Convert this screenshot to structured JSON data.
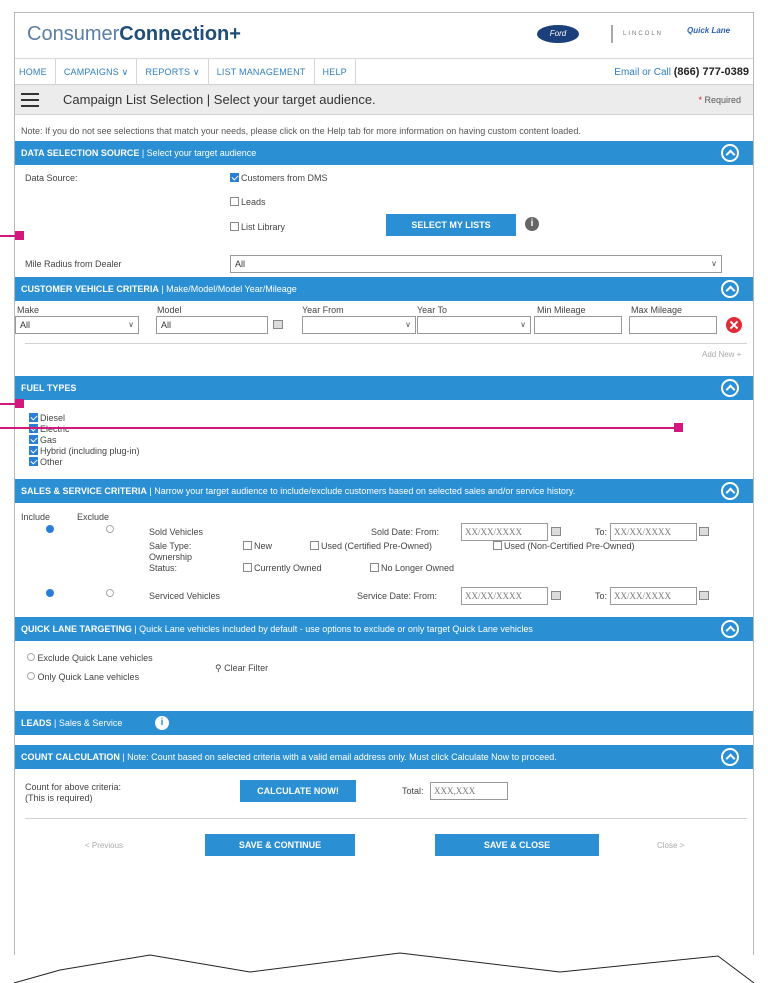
{
  "header": {
    "brand_light": "Consumer",
    "brand_bold": "Connection+",
    "ford_logo": "Ford",
    "lincoln_logo": "LINCOLN",
    "quicklane_logo": "Quick Lane"
  },
  "nav": {
    "items": [
      "HOME",
      "CAMPAIGNS ∨",
      "REPORTS ∨",
      "LIST MANAGEMENT",
      "HELP"
    ],
    "contact_prefix": "Email or Call",
    "contact_phone": "(866) 777-0389"
  },
  "titlebar": {
    "title": "Campaign List Selection | Select your target audience.",
    "required_star": "*",
    "required_label": "Required"
  },
  "note": "Note: If you do not see selections that match your needs, please click on the Help tab for more information on having custom content loaded.",
  "data_source": {
    "bar_title": "DATA SELECTION SOURCE",
    "bar_sub": " | Select your target audience",
    "label": "Data Source:",
    "options": [
      "Customers from DMS",
      "Leads",
      "List Library"
    ],
    "checked": [
      true,
      false,
      false
    ],
    "select_lists_button": "SELECT MY LISTS",
    "radius_label": "Mile Radius from Dealer",
    "radius_value": "All"
  },
  "vehicle": {
    "bar_title": "CUSTOMER VEHICLE CRITERIA",
    "bar_sub": " | Make/Model/Model Year/Mileage",
    "headers": [
      "Make",
      "Model",
      "Year From",
      "Year To",
      "Min Mileage",
      "Max Mileage"
    ],
    "make": "All",
    "model": "All",
    "add_new": "Add New +"
  },
  "fuel": {
    "bar_title": "FUEL TYPES",
    "types": [
      "Diesel",
      "Electric",
      "Gas",
      "Hybrid (including plug-in)",
      "Other"
    ]
  },
  "sales": {
    "bar_title": "SALES & SERVICE CRITERIA",
    "bar_sub": " | Narrow your target audience to include/exclude customers based on selected sales and/or service history.",
    "include": "Include",
    "exclude": "Exclude",
    "sold_vehicles": "Sold Vehicles",
    "sold_date_label": "Sold Date:",
    "from": "From:",
    "to": "To:",
    "date_placeholder": "XX/XX/XXXX",
    "sale_type_label": "Sale Type:",
    "sale_types": [
      "New",
      "Used (Certified Pre-Owned)",
      "Used (Non-Certified Pre-Owned)"
    ],
    "ownership_label_1": "Ownership",
    "ownership_label_2": "Status:",
    "ownership": [
      "Currently Owned",
      "No Longer Owned"
    ],
    "serviced_vehicles": "Serviced Vehicles",
    "service_date_label": "Service Date:"
  },
  "quicklane": {
    "bar_title": "QUICK LANE TARGETING",
    "bar_sub": " | Quick Lane vehicles included by default - use options to exclude or only target Quick Lane vehicles",
    "options": [
      "Exclude Quick Lane vehicles",
      "Only Quick Lane vehicles"
    ],
    "clear_filter": "Clear Filter"
  },
  "leads": {
    "bar_title": "LEADS",
    "bar_sub": " | Sales & Service"
  },
  "count": {
    "bar_title": "COUNT CALCULATION",
    "bar_sub": " | Note: Count based on selected criteria with a valid email address only. Must click Calculate Now to proceed.",
    "label_1": "Count for above criteria:",
    "label_2": "(This is required)",
    "calculate_button": "CALCULATE NOW!",
    "total_label": "Total:",
    "total_value": "XXX,XXX"
  },
  "footer": {
    "previous": "< Previous",
    "save_continue": "SAVE & CONTINUE",
    "save_close": "SAVE & CLOSE",
    "close": "Close >"
  },
  "colors": {
    "section_blue": "#2a8fd3",
    "callout_magenta": "#d4167f",
    "link_blue": "#2f7fc1",
    "remove_red": "#e02c36"
  }
}
